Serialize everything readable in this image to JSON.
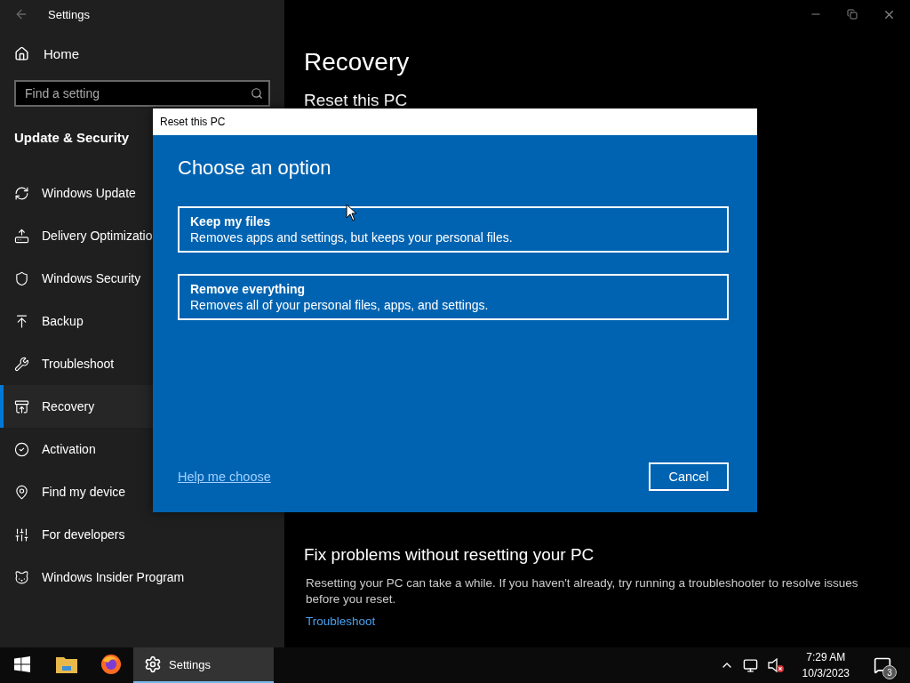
{
  "window": {
    "title": "Settings"
  },
  "sidebar": {
    "home": "Home",
    "search": {
      "placeholder": "Find a setting"
    },
    "section": "Update & Security",
    "items": [
      {
        "label": "Windows Update",
        "kind": "update",
        "selected": false
      },
      {
        "label": "Delivery Optimizatio",
        "kind": "delivery",
        "selected": false
      },
      {
        "label": "Windows Security",
        "kind": "security",
        "selected": false
      },
      {
        "label": "Backup",
        "kind": "backup",
        "selected": false
      },
      {
        "label": "Troubleshoot",
        "kind": "troubleshoot",
        "selected": false
      },
      {
        "label": "Recovery",
        "kind": "recovery",
        "selected": true
      },
      {
        "label": "Activation",
        "kind": "activation",
        "selected": false
      },
      {
        "label": "Find my device",
        "kind": "find",
        "selected": false
      },
      {
        "label": "For developers",
        "kind": "developers",
        "selected": false
      },
      {
        "label": "Windows Insider Program",
        "kind": "insider",
        "selected": false
      }
    ]
  },
  "page": {
    "title": "Recovery",
    "section": "Reset this PC",
    "fix_heading": "Fix problems without resetting your PC",
    "fix_text": "Resetting your PC can take a while. If you haven't already, try running a troubleshooter to resolve issues before you reset.",
    "fix_link": "Troubleshoot"
  },
  "dialog": {
    "title": "Reset this PC",
    "heading": "Choose an option",
    "options": [
      {
        "title": "Keep my files",
        "description": "Removes apps and settings, but keeps your personal files."
      },
      {
        "title": "Remove everything",
        "description": "Removes all of your personal files, apps, and settings."
      }
    ],
    "help_link": "Help me choose",
    "cancel": "Cancel"
  },
  "taskbar": {
    "apps": [
      {
        "kind": "start",
        "active": false
      },
      {
        "kind": "explorer",
        "active": false
      },
      {
        "kind": "firefox",
        "active": false
      },
      {
        "kind": "settings",
        "label": "Settings",
        "active": true
      }
    ],
    "time": "7:29 AM",
    "date": "10/3/2023",
    "notifications": "3"
  }
}
